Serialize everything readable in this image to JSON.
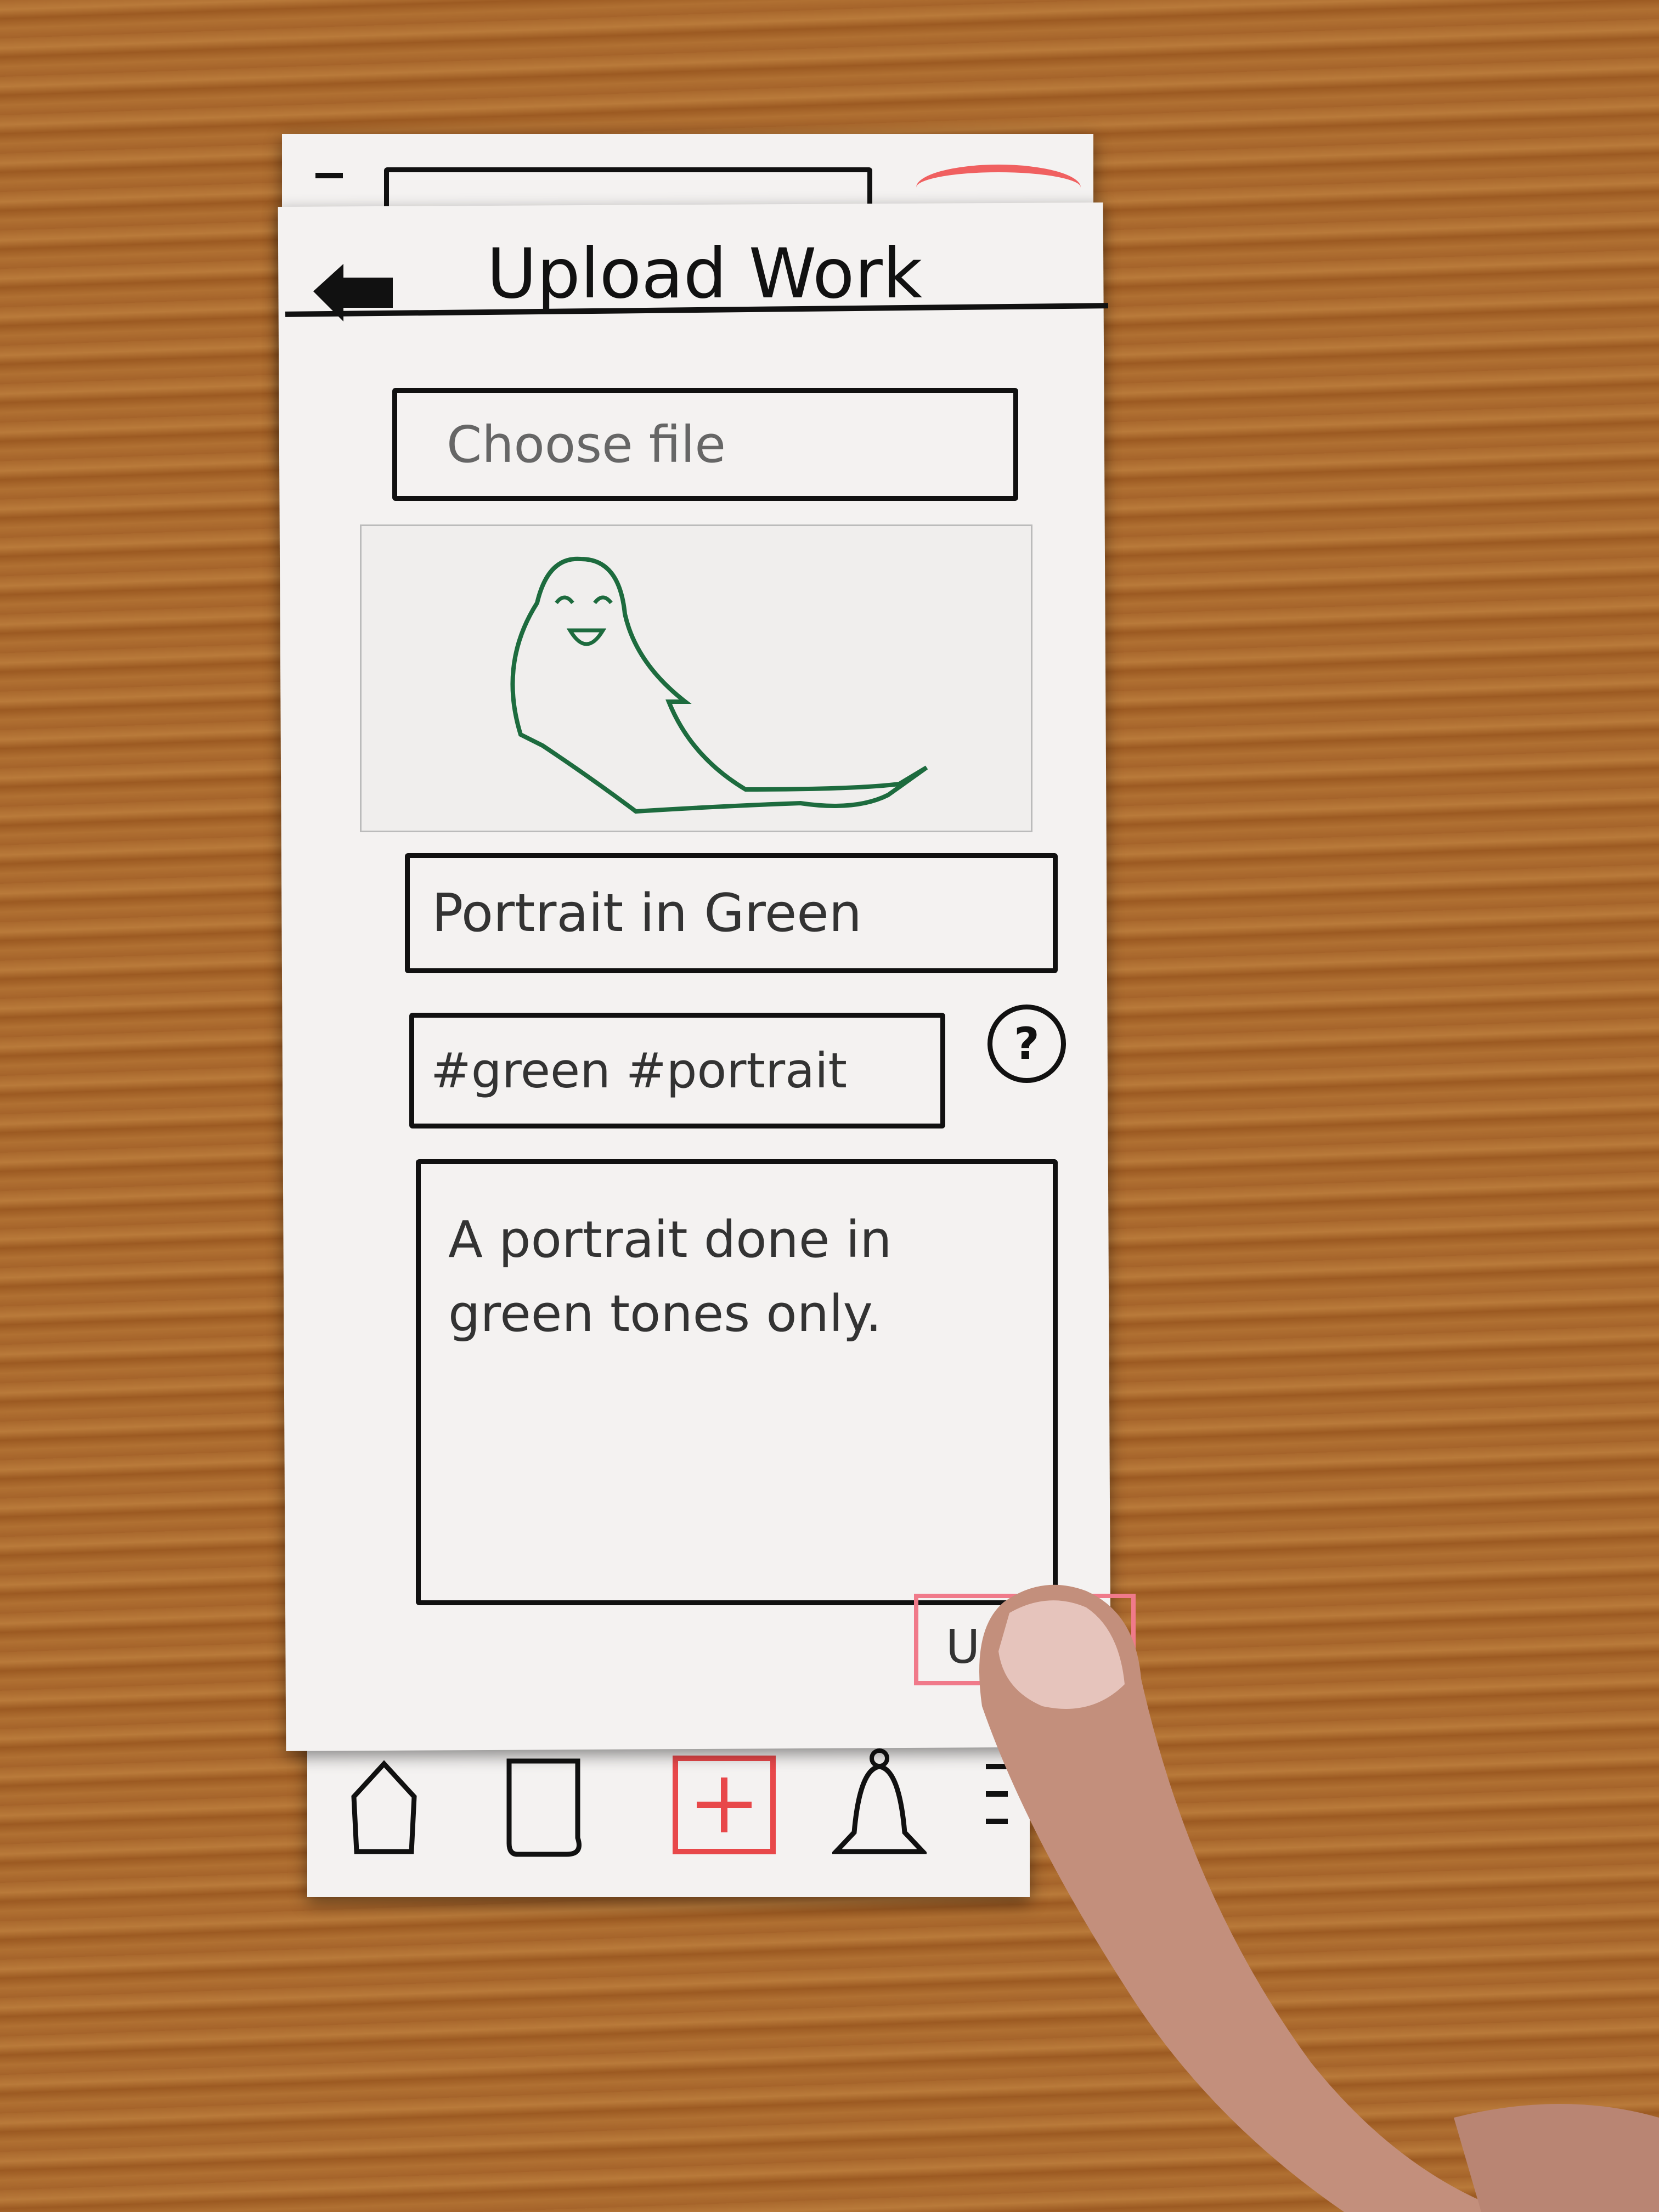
{
  "header": {
    "title": "Upload Work",
    "back_icon": "arrow-left-icon"
  },
  "form": {
    "file_picker_placeholder": "Choose file",
    "title_value": "Portrait in Green",
    "tags_value": "#green #portrait",
    "help_label": "?",
    "description_value": "A portrait done in green tones only.",
    "submit_label_visible": "U"
  },
  "bottom_nav": {
    "items": [
      {
        "icon": "home-icon"
      },
      {
        "icon": "document-icon"
      },
      {
        "icon": "plus-icon"
      },
      {
        "icon": "bell-icon"
      },
      {
        "icon": "menu-icon"
      }
    ]
  },
  "colors": {
    "accent": "#e8484a",
    "ink": "#111111",
    "drawing": "#1d6b3e",
    "paper": "#f4f2f1"
  }
}
